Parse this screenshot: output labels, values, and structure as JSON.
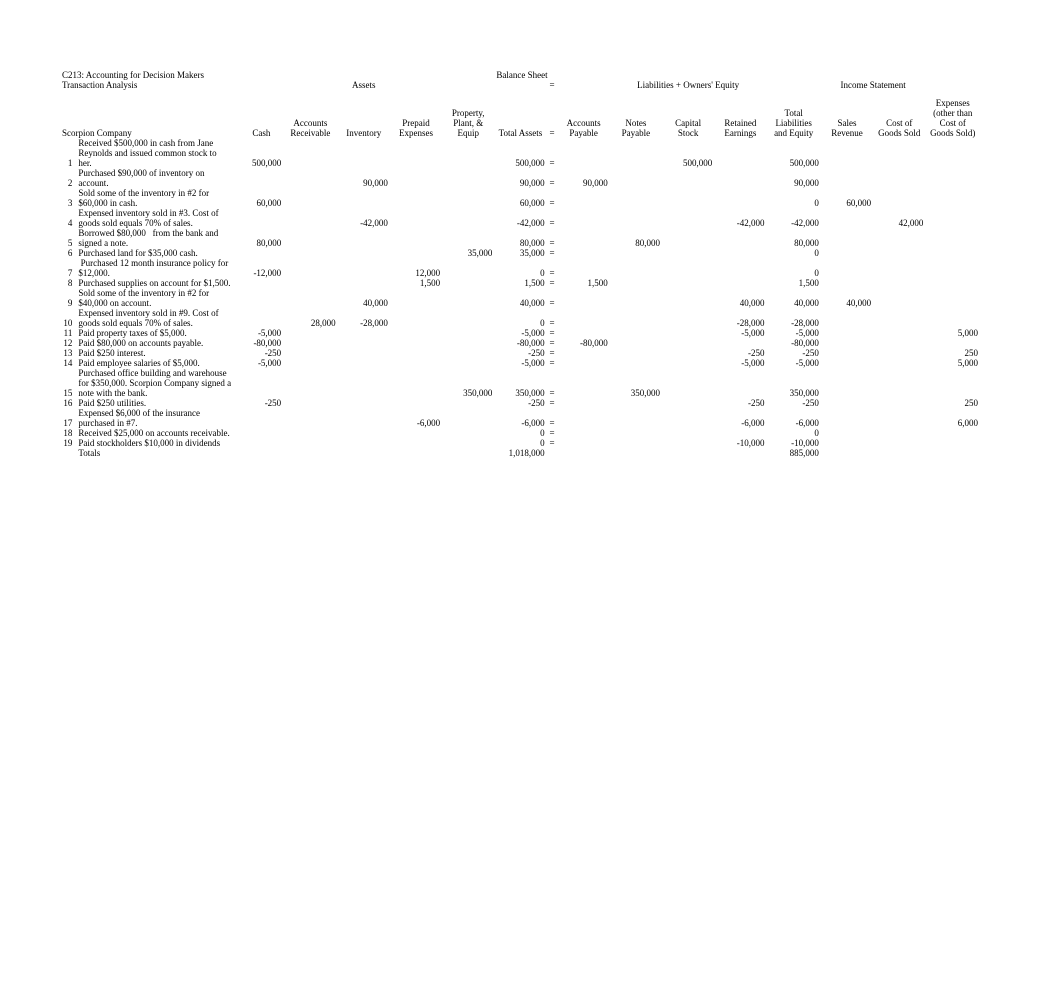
{
  "header": {
    "course": "C213: Accounting for Decision Makers",
    "balance_sheet": "Balance Sheet",
    "txn_analysis": "Transaction Analysis",
    "assets": "Assets",
    "eq_top": "=",
    "liab_equity": "Liabilities + Owners' Equity",
    "income_stmt": "Income Statement",
    "company": "Scorpion Company",
    "cols": {
      "cash": "Cash",
      "ar": "Accounts Receivable",
      "inv": "Inventory",
      "pre": "Prepaid Expenses",
      "ppe": "Property, Plant, & Equip",
      "ta": "Total Assets",
      "eq": "=",
      "ap": "Accounts Payable",
      "np": "Notes Payable",
      "cs": "Capital Stock",
      "re": "Retained Earnings",
      "tle": "Total Liabilities and Equity",
      "sr": "Sales Revenue",
      "cogs": "Cost of Goods Sold",
      "exp": "Expenses (other than Cost of Goods Sold)"
    }
  },
  "rows": [
    {
      "n": "1",
      "desc": "Received $500,000 in cash from Jane Reynolds and issued common stock to her.",
      "cash": "500,000",
      "ar": "",
      "inv": "",
      "pre": "",
      "ppe": "",
      "ta": "500,000",
      "eq": "=",
      "ap": "",
      "np": "",
      "cs": "500,000",
      "re": "",
      "tle": "500,000",
      "sr": "",
      "cogs": "",
      "exp": ""
    },
    {
      "n": "2",
      "desc": "Purchased $90,000 of inventory on account.",
      "cash": "",
      "ar": "",
      "inv": "90,000",
      "pre": "",
      "ppe": "",
      "ta": "90,000",
      "eq": "=",
      "ap": "90,000",
      "np": "",
      "cs": "",
      "re": "",
      "tle": "90,000",
      "sr": "",
      "cogs": "",
      "exp": ""
    },
    {
      "n": "3",
      "desc": "Sold some of the inventory in #2 for $60,000 in cash.",
      "cash": "60,000",
      "ar": "",
      "inv": "",
      "pre": "",
      "ppe": "",
      "ta": "60,000",
      "eq": "=",
      "ap": "",
      "np": "",
      "cs": "",
      "re": "",
      "tle": "0",
      "sr": "60,000",
      "cogs": "",
      "exp": ""
    },
    {
      "n": "4",
      "desc": "Expensed inventory sold in #3. Cost of goods sold equals 70% of sales.",
      "cash": "",
      "ar": "",
      "inv": "-42,000",
      "pre": "",
      "ppe": "",
      "ta": "-42,000",
      "eq": "=",
      "ap": "",
      "np": "",
      "cs": "",
      "re": "-42,000",
      "tle": "-42,000",
      "sr": "",
      "cogs": "42,000",
      "exp": ""
    },
    {
      "n": "5",
      "desc": "Borrowed $80,000   from the bank and signed a note.",
      "cash": "80,000",
      "ar": "",
      "inv": "",
      "pre": "",
      "ppe": "",
      "ta": "80,000",
      "eq": "=",
      "ap": "",
      "np": "80,000",
      "cs": "",
      "re": "",
      "tle": "80,000",
      "sr": "",
      "cogs": "",
      "exp": ""
    },
    {
      "n": "6",
      "desc": "Purchased land for $35,000 cash.",
      "cash": "",
      "ar": "",
      "inv": "",
      "pre": "",
      "ppe": "35,000",
      "ta": "35,000",
      "eq": "=",
      "ap": "",
      "np": "",
      "cs": "",
      "re": "",
      "tle": "0",
      "sr": "",
      "cogs": "",
      "exp": ""
    },
    {
      "n": "7",
      "desc": " Purchased 12 month insurance policy for $12,000.",
      "cash": "-12,000",
      "ar": "",
      "inv": "",
      "pre": "12,000",
      "ppe": "",
      "ta": "0",
      "eq": "=",
      "ap": "",
      "np": "",
      "cs": "",
      "re": "",
      "tle": "0",
      "sr": "",
      "cogs": "",
      "exp": ""
    },
    {
      "n": "8",
      "desc": "Purchased supplies on account for $1,500.",
      "cash": "",
      "ar": "",
      "inv": "",
      "pre": "1,500",
      "ppe": "",
      "ta": "1,500",
      "eq": "=",
      "ap": "1,500",
      "np": "",
      "cs": "",
      "re": "",
      "tle": "1,500",
      "sr": "",
      "cogs": "",
      "exp": ""
    },
    {
      "n": "9",
      "desc": "Sold some of the inventory in #2 for $40,000 on account.",
      "cash": "",
      "ar": "",
      "inv": "40,000",
      "pre": "",
      "ppe": "",
      "ta": "40,000",
      "eq": "=",
      "ap": "",
      "np": "",
      "cs": "",
      "re": "40,000",
      "tle": "40,000",
      "sr": "40,000",
      "cogs": "",
      "exp": ""
    },
    {
      "n": "10",
      "desc": "Expensed inventory sold in #9. Cost of goods sold equals 70% of sales.",
      "cash": "",
      "ar": "28,000",
      "inv": "-28,000",
      "pre": "",
      "ppe": "",
      "ta": "0",
      "eq": "=",
      "ap": "",
      "np": "",
      "cs": "",
      "re": "-28,000",
      "tle": "-28,000",
      "sr": "",
      "cogs": "",
      "exp": ""
    },
    {
      "n": "11",
      "desc": "Paid property taxes of $5,000.",
      "cash": "-5,000",
      "ar": "",
      "inv": "",
      "pre": "",
      "ppe": "",
      "ta": "-5,000",
      "eq": "=",
      "ap": "",
      "np": "",
      "cs": "",
      "re": "-5,000",
      "tle": "-5,000",
      "sr": "",
      "cogs": "",
      "exp": "5,000"
    },
    {
      "n": "12",
      "desc": "Paid $80,000 on accounts payable.",
      "cash": "-80,000",
      "ar": "",
      "inv": "",
      "pre": "",
      "ppe": "",
      "ta": "-80,000",
      "eq": "=",
      "ap": "-80,000",
      "np": "",
      "cs": "",
      "re": "",
      "tle": "-80,000",
      "sr": "",
      "cogs": "",
      "exp": ""
    },
    {
      "n": "13",
      "desc": "Paid $250 interest.",
      "cash": "-250",
      "ar": "",
      "inv": "",
      "pre": "",
      "ppe": "",
      "ta": "-250",
      "eq": "=",
      "ap": "",
      "np": "",
      "cs": "",
      "re": "-250",
      "tle": "-250",
      "sr": "",
      "cogs": "",
      "exp": "250"
    },
    {
      "n": "14",
      "desc": "Paid employee salaries of $5,000.",
      "cash": "-5,000",
      "ar": "",
      "inv": "",
      "pre": "",
      "ppe": "",
      "ta": "-5,000",
      "eq": "=",
      "ap": "",
      "np": "",
      "cs": "",
      "re": "-5,000",
      "tle": "-5,000",
      "sr": "",
      "cogs": "",
      "exp": "5,000"
    },
    {
      "n": "15",
      "desc": "Purchased office building and warehouse for $350,000. Scorpion Company signed a note with the bank.",
      "cash": "",
      "ar": "",
      "inv": "",
      "pre": "",
      "ppe": "350,000",
      "ta": "350,000",
      "eq": "=",
      "ap": "",
      "np": "350,000",
      "cs": "",
      "re": "",
      "tle": "350,000",
      "sr": "",
      "cogs": "",
      "exp": ""
    },
    {
      "n": "16",
      "desc": "Paid $250 utilities.",
      "cash": "-250",
      "ar": "",
      "inv": "",
      "pre": "",
      "ppe": "",
      "ta": "-250",
      "eq": "=",
      "ap": "",
      "np": "",
      "cs": "",
      "re": "-250",
      "tle": "-250",
      "sr": "",
      "cogs": "",
      "exp": "250"
    },
    {
      "n": "17",
      "desc": "Expensed $6,000 of the insurance purchased in #7.",
      "cash": "",
      "ar": "",
      "inv": "",
      "pre": "-6,000",
      "ppe": "",
      "ta": "-6,000",
      "eq": "=",
      "ap": "",
      "np": "",
      "cs": "",
      "re": "-6,000",
      "tle": "-6,000",
      "sr": "",
      "cogs": "",
      "exp": "6,000"
    },
    {
      "n": "18",
      "desc": "Received $25,000 on accounts receivable.",
      "cash": "",
      "ar": "",
      "inv": "",
      "pre": "",
      "ppe": "",
      "ta": "0",
      "eq": "=",
      "ap": "",
      "np": "",
      "cs": "",
      "re": "",
      "tle": "0",
      "sr": "",
      "cogs": "",
      "exp": ""
    },
    {
      "n": "19",
      "desc": "Paid stockholders $10,000 in dividends",
      "cash": "",
      "ar": "",
      "inv": "",
      "pre": "",
      "ppe": "",
      "ta": "0",
      "eq": "=",
      "ap": "",
      "np": "",
      "cs": "",
      "re": "-10,000",
      "tle": "-10,000",
      "sr": "",
      "cogs": "",
      "exp": ""
    }
  ],
  "totals": {
    "label": "Totals",
    "ta": "1,018,000",
    "tle": "885,000"
  }
}
